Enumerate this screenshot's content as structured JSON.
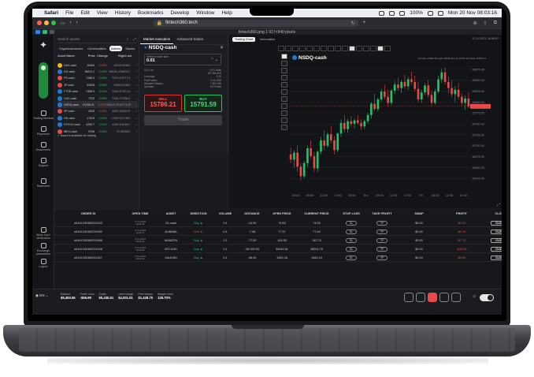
{
  "menubar": {
    "app": "Safari",
    "items": [
      "File",
      "Edit",
      "View",
      "History",
      "Bookmarks",
      "Develop",
      "Window",
      "Help"
    ],
    "battery": "100%",
    "clock": "Mon 20 Nov 08:03:16"
  },
  "browser": {
    "url": "fintech360.tech",
    "tab_title": "fintech360.png 1 917×940 pixels"
  },
  "nav": [
    {
      "label": "Trading terminal"
    },
    {
      "label": "Payments"
    },
    {
      "label": "Documents"
    },
    {
      "label": "Support"
    },
    {
      "label": "Statement"
    },
    {
      "label": "Bank Card Verification"
    },
    {
      "label": "Exchange parameters"
    },
    {
      "label": "Logout"
    }
  ],
  "assets": {
    "search_placeholder": "Search assets",
    "categories": [
      "Cryptocurrencies",
      "Commodities",
      "Indices",
      "Stocks"
    ],
    "active_category": "Indices",
    "headers": {
      "name": "Asset Name",
      "price": "Price",
      "change": "Change",
      "hl": "High/Low"
    },
    "rows": [
      {
        "name": "DAX-cash",
        "price": "16494",
        "change": "-0.05%",
        "hl": "16512/16464",
        "color": "#f2b705"
      },
      {
        "name": "DJI-cash",
        "price": "35911.1",
        "change": "0.18%",
        "hl": "35935.1/35870.2",
        "color": "#1d7bd6"
      },
      {
        "name": "FR-cash",
        "price": "7286.9",
        "change": "0.06%",
        "hl": "7291.5/7277.4",
        "color": "#e84a4a"
      },
      {
        "name": "JP-cash",
        "price": "33538",
        "change": "0.55%",
        "hl": "33642/33462",
        "color": "#e84a4a"
      },
      {
        "name": "FTSE-cash",
        "price": "7488.9",
        "change": "0.12%",
        "hl": "7493.9/7471.6",
        "color": "#1d7bd6"
      },
      {
        "name": "CAC-cash",
        "price": "7323",
        "change": "0.06%",
        "hl": "7344.2/7298.5",
        "color": "#1d7bd6"
      },
      {
        "name": "NSDQ-cash",
        "price": "15786.21",
        "change": "-0.25%",
        "hl": "15823.20/15774.30",
        "color": "#1d7bd6"
      },
      {
        "name": "SP-cash",
        "price": "4525",
        "change": "-0.15%",
        "hl": "4529.3/4520.8",
        "color": "#e84a4a"
      },
      {
        "name": "HK-cash",
        "price": "17615",
        "change": "1.22%",
        "hl": "17629.3/17402",
        "color": "#1d7bd6"
      },
      {
        "name": "STOXX-cash",
        "price": "4255.7",
        "change": "0.01%",
        "hl": "4258.3/4248.2",
        "color": "#1d7bd6"
      },
      {
        "name": "IBEX-cash",
        "price": "9706",
        "change": "0.16%",
        "hl": "9718/9691",
        "color": "#e84a4a"
      }
    ],
    "notice": "Asset is available for trading"
  },
  "execution": {
    "tabs": [
      "Market execution",
      "Advanced trades"
    ],
    "symbol": "NSDQ-cash",
    "size_label": "Select a trade size",
    "size_value": "0.01",
    "info": [
      {
        "k": "0.01 Lot",
        "v": "0.01 Units"
      },
      {
        "k": "",
        "v": "157.86 USD"
      },
      {
        "k": "Leverage:",
        "v": "1:20"
      },
      {
        "k": "Point Value:",
        "v": "0.01 USD"
      },
      {
        "k": "Required Margin:",
        "v": "7.89 USD"
      },
      {
        "k": "Spreads:",
        "v": "5.3 Points"
      }
    ],
    "sell_label": "SELL",
    "sell_price": "15786.21",
    "buy_label": "BUY",
    "buy_price": "15791.59",
    "trade_label": "Trade"
  },
  "chart_panel": {
    "tabs": [
      "Trading Chart",
      "Information"
    ],
    "datetime": "17.11.2023, 19:48:57",
    "ohlc": "1h   Open 15802.30  High 15843.20  Low 15787.20  Close 15786.21"
  },
  "chart_data": {
    "type": "candlestick",
    "title": "NSDQ-cash",
    "ylim": [
      15600,
      15900
    ],
    "x_ticks": [
      "00:00",
      "09:00",
      "12:00",
      "17:00",
      "20:00",
      "Thu",
      "09:00",
      "12:00",
      "17:00",
      "Fri",
      "09:00",
      "12:00",
      "17:00"
    ],
    "y_ticks": [
      "15875.00",
      "15850.00",
      "15825.00",
      "15800.00",
      "15775.00",
      "15750.00",
      "15725.00",
      "15700.00",
      "15675.00",
      "15650.00",
      "15625.00"
    ],
    "candles": [
      {
        "o": 15680,
        "h": 15695,
        "l": 15660,
        "c": 15668
      },
      {
        "o": 15668,
        "h": 15690,
        "l": 15650,
        "c": 15684
      },
      {
        "o": 15684,
        "h": 15700,
        "l": 15640,
        "c": 15652
      },
      {
        "o": 15652,
        "h": 15660,
        "l": 15620,
        "c": 15630
      },
      {
        "o": 15630,
        "h": 15665,
        "l": 15625,
        "c": 15660
      },
      {
        "o": 15660,
        "h": 15700,
        "l": 15650,
        "c": 15694
      },
      {
        "o": 15694,
        "h": 15712,
        "l": 15670,
        "c": 15676
      },
      {
        "o": 15676,
        "h": 15686,
        "l": 15640,
        "c": 15648
      },
      {
        "o": 15648,
        "h": 15690,
        "l": 15640,
        "c": 15686
      },
      {
        "o": 15686,
        "h": 15720,
        "l": 15680,
        "c": 15712
      },
      {
        "o": 15712,
        "h": 15735,
        "l": 15690,
        "c": 15700
      },
      {
        "o": 15700,
        "h": 15730,
        "l": 15695,
        "c": 15726
      },
      {
        "o": 15726,
        "h": 15745,
        "l": 15705,
        "c": 15712
      },
      {
        "o": 15712,
        "h": 15722,
        "l": 15680,
        "c": 15690
      },
      {
        "o": 15690,
        "h": 15730,
        "l": 15685,
        "c": 15728
      },
      {
        "o": 15728,
        "h": 15760,
        "l": 15720,
        "c": 15752
      },
      {
        "o": 15752,
        "h": 15770,
        "l": 15730,
        "c": 15738
      },
      {
        "o": 15738,
        "h": 15762,
        "l": 15730,
        "c": 15756
      },
      {
        "o": 15756,
        "h": 15768,
        "l": 15744,
        "c": 15750
      },
      {
        "o": 15750,
        "h": 15762,
        "l": 15740,
        "c": 15758
      },
      {
        "o": 15758,
        "h": 15770,
        "l": 15748,
        "c": 15752
      },
      {
        "o": 15752,
        "h": 15760,
        "l": 15736,
        "c": 15744
      },
      {
        "o": 15744,
        "h": 15760,
        "l": 15738,
        "c": 15756
      },
      {
        "o": 15756,
        "h": 15775,
        "l": 15750,
        "c": 15770
      },
      {
        "o": 15770,
        "h": 15800,
        "l": 15762,
        "c": 15796
      },
      {
        "o": 15796,
        "h": 15820,
        "l": 15780,
        "c": 15784
      },
      {
        "o": 15784,
        "h": 15810,
        "l": 15778,
        "c": 15806
      },
      {
        "o": 15806,
        "h": 15830,
        "l": 15800,
        "c": 15824
      },
      {
        "o": 15824,
        "h": 15840,
        "l": 15806,
        "c": 15812
      },
      {
        "o": 15812,
        "h": 15828,
        "l": 15790,
        "c": 15798
      },
      {
        "o": 15798,
        "h": 15830,
        "l": 15792,
        "c": 15826
      },
      {
        "o": 15826,
        "h": 15848,
        "l": 15818,
        "c": 15840
      },
      {
        "o": 15840,
        "h": 15856,
        "l": 15826,
        "c": 15832
      },
      {
        "o": 15832,
        "h": 15850,
        "l": 15820,
        "c": 15846
      },
      {
        "o": 15846,
        "h": 15862,
        "l": 15830,
        "c": 15836
      },
      {
        "o": 15836,
        "h": 15858,
        "l": 15828,
        "c": 15852
      },
      {
        "o": 15852,
        "h": 15870,
        "l": 15840,
        "c": 15846
      },
      {
        "o": 15846,
        "h": 15860,
        "l": 15824,
        "c": 15830
      },
      {
        "o": 15830,
        "h": 15846,
        "l": 15800,
        "c": 15806
      },
      {
        "o": 15806,
        "h": 15828,
        "l": 15798,
        "c": 15822
      },
      {
        "o": 15822,
        "h": 15844,
        "l": 15816,
        "c": 15838
      },
      {
        "o": 15838,
        "h": 15850,
        "l": 15810,
        "c": 15816
      },
      {
        "o": 15816,
        "h": 15826,
        "l": 15790,
        "c": 15798
      },
      {
        "o": 15798,
        "h": 15830,
        "l": 15794,
        "c": 15824
      },
      {
        "o": 15824,
        "h": 15860,
        "l": 15820,
        "c": 15852
      },
      {
        "o": 15852,
        "h": 15876,
        "l": 15844,
        "c": 15868
      },
      {
        "o": 15868,
        "h": 15880,
        "l": 15840,
        "c": 15846
      },
      {
        "o": 15846,
        "h": 15858,
        "l": 15820,
        "c": 15832
      },
      {
        "o": 15832,
        "h": 15850,
        "l": 15812,
        "c": 15818
      },
      {
        "o": 15818,
        "h": 15836,
        "l": 15800,
        "c": 15828
      },
      {
        "o": 15828,
        "h": 15844,
        "l": 15806,
        "c": 15812
      },
      {
        "o": 15812,
        "h": 15820,
        "l": 15790,
        "c": 15798
      },
      {
        "o": 15798,
        "h": 15815,
        "l": 15782,
        "c": 15808
      },
      {
        "o": 15808,
        "h": 15822,
        "l": 15786,
        "c": 15790
      }
    ],
    "colors": {
      "up": "#26c26a",
      "down": "#e84a4a",
      "grid": "#22242a",
      "axis": "#8a8d94"
    }
  },
  "orders": {
    "headers": [
      "ORDER ID",
      "OPEN TIME",
      "ASSET",
      "DIRECTION",
      "VOLUME",
      "DISTANCE",
      "OPEN PRICE",
      "CURRENT PRICE",
      "STOP LOSS",
      "TAKE PROFIT",
      "SWAP",
      "PROFIT",
      "CLOSE"
    ],
    "rows": [
      {
        "id": "#0411251982251523",
        "date": "17.11.2023",
        "time": "16:41:42",
        "asset": "GL-cash",
        "dir": "Buy",
        "vol": "0.1",
        "dist": "-10.90",
        "open": "74.63",
        "cur": "74.53",
        "sl": "SL",
        "tp": "TP",
        "swap": "$0.00",
        "profit": "-$1.00",
        "close": "CLOSE"
      },
      {
        "id": "#0411251982251582",
        "date": "17.11.2023",
        "time": "16:41:47",
        "asset": "AUBABA",
        "dir": "Sell",
        "vol": "0.1",
        "dist": "-7.08",
        "open": "77.37",
        "cur": "77.44",
        "sl": "SL",
        "tp": "TP",
        "swap": "$0.00",
        "profit": "-$0.70",
        "close": "CLOSE"
      },
      {
        "id": "#0411251982251586",
        "date": "17.11.2023",
        "time": "16:42:01",
        "asset": "AMAZON",
        "dir": "Buy",
        "vol": "0.1",
        "dist": "-77.00",
        "open": "143.50",
        "cur": "142.73",
        "sl": "SL",
        "tp": "TP",
        "swap": "$0.00",
        "profit": "-$7.70",
        "close": "CLOSE"
      },
      {
        "id": "#0411251982251526",
        "date": "17.11.2023",
        "time": "16:42:09",
        "asset": "BTCUSD",
        "dir": "Buy",
        "vol": "0.1",
        "dist": "-36,990.00",
        "open": "36444.61",
        "cur": "36004.75",
        "sl": "SL",
        "tp": "TP",
        "swap": "$0.00",
        "profit": "-$36.99",
        "close": "CLOSE"
      },
      {
        "id": "#0411251982251527",
        "date": "17.11.2023",
        "time": "16:42:14",
        "asset": "XAUUSD",
        "dir": "Buy",
        "vol": "0.1",
        "dist": "-96.00",
        "open": "1981.28",
        "cur": "1982.15",
        "sl": "SL",
        "tp": "TP",
        "swap": "$0.00",
        "profit": "-$9.60",
        "close": "CLOSE"
      }
    ]
  },
  "footer": {
    "language": "EN",
    "stats": [
      {
        "k": "Balance",
        "v": "$5,493.56"
      },
      {
        "k": "Profit / Loss",
        "v": "-$65.99"
      },
      {
        "k": "Equity",
        "v": "$5,430.61"
      },
      {
        "k": "Used Margin",
        "v": "$4,001.91"
      },
      {
        "k": "Free Margin",
        "v": "$1,428.70"
      },
      {
        "k": "Margin Level",
        "v": "135.70%"
      }
    ]
  }
}
